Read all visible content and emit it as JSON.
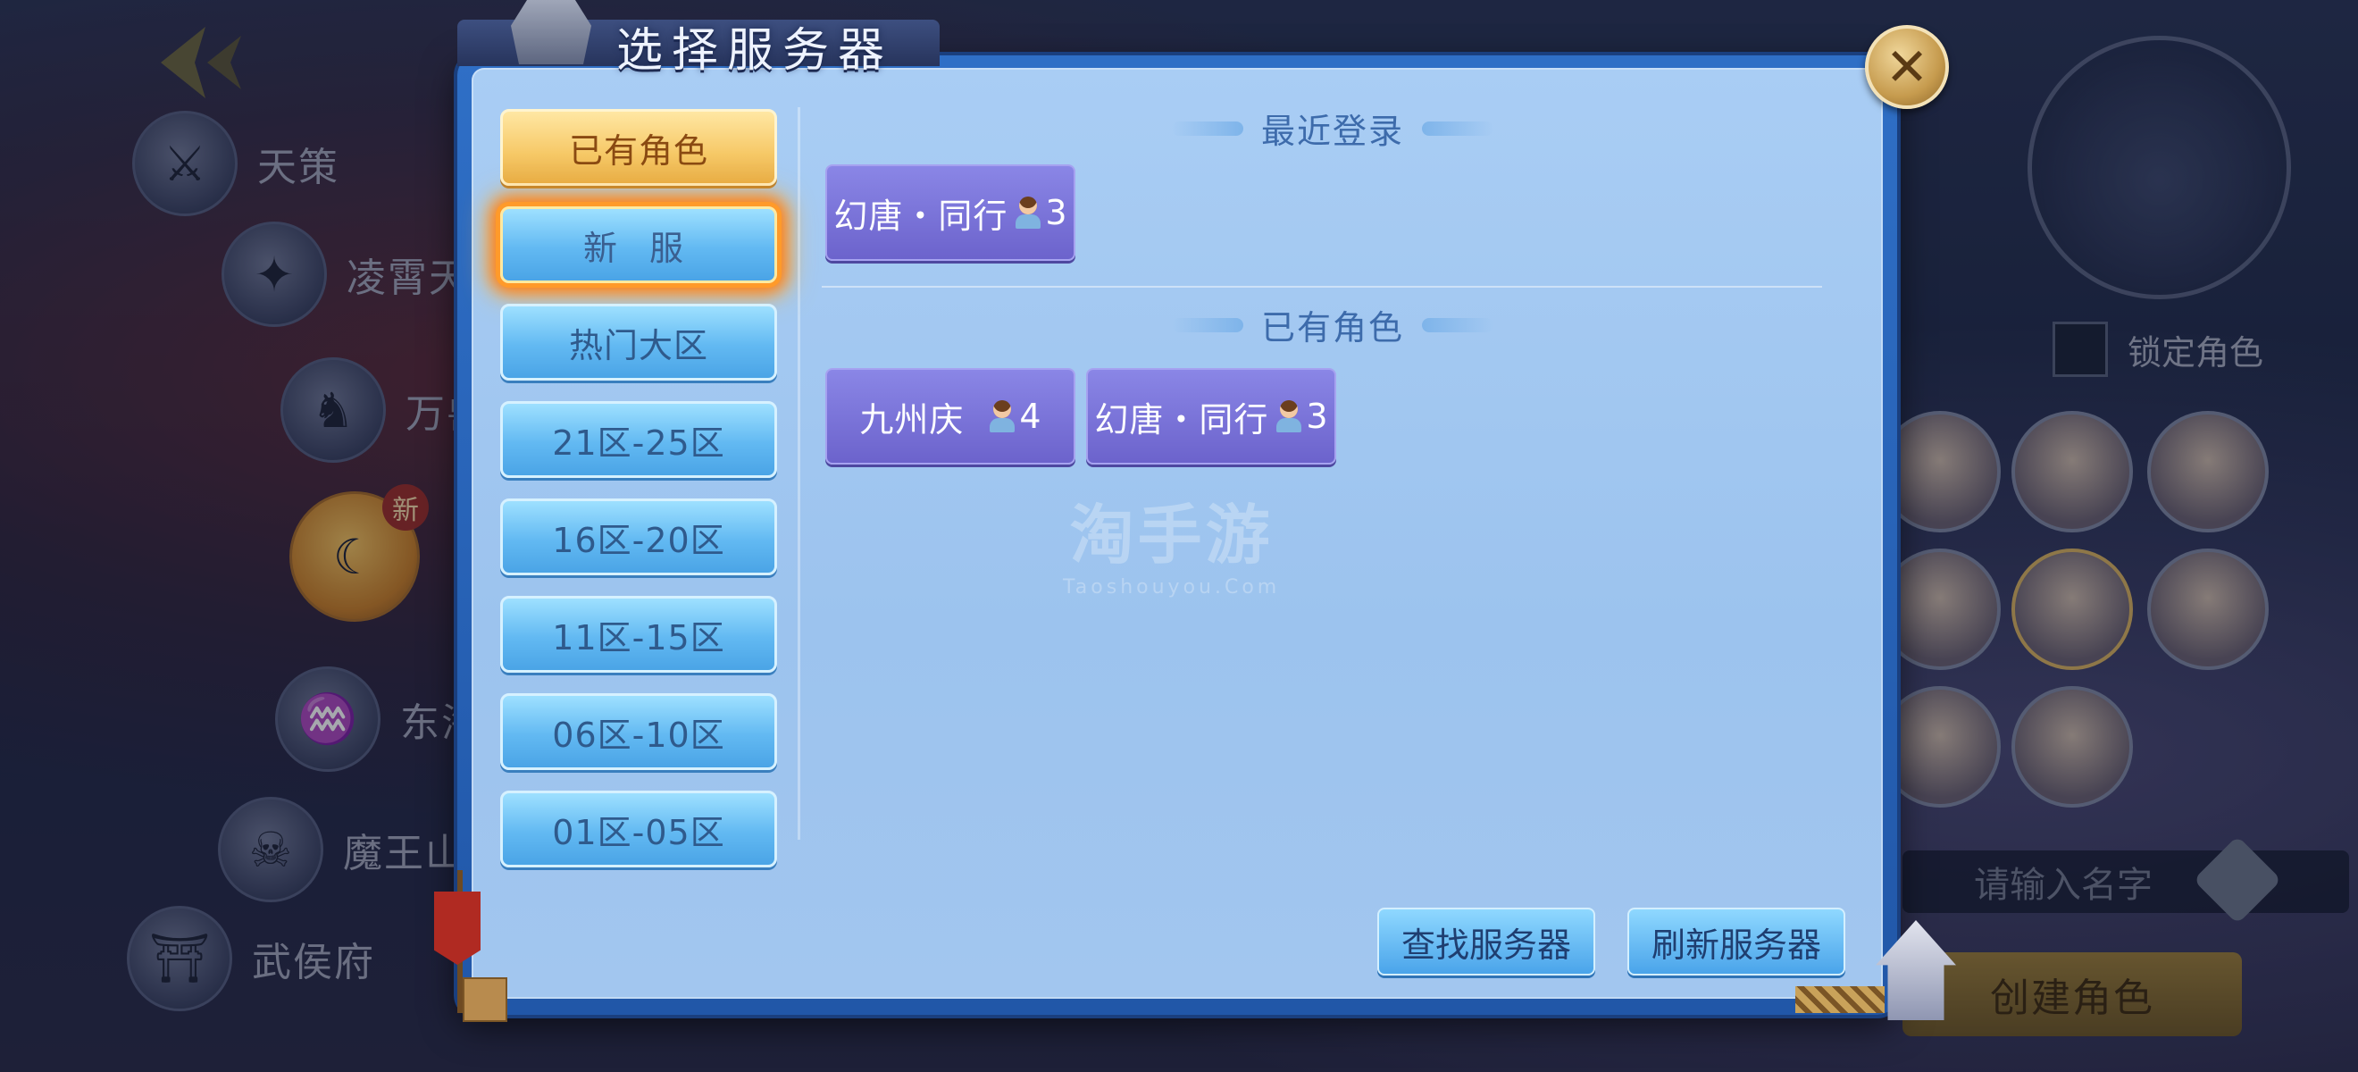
{
  "dialog": {
    "title": "选择服务器",
    "close_symbol": "✕"
  },
  "tabs": [
    {
      "label": "已有角色",
      "state": "selected"
    },
    {
      "label": "新 服",
      "state": "highlight"
    },
    {
      "label": "热门大区",
      "state": "normal"
    },
    {
      "label": "21区-25区",
      "state": "normal"
    },
    {
      "label": "16区-20区",
      "state": "normal"
    },
    {
      "label": "11区-15区",
      "state": "normal"
    },
    {
      "label": "06区-10区",
      "state": "normal"
    },
    {
      "label": "01区-05区",
      "state": "normal"
    }
  ],
  "recent": {
    "title": "最近登录",
    "servers": [
      {
        "name": "幻唐・同行",
        "count": "3"
      }
    ]
  },
  "owned": {
    "title": "已有角色",
    "servers": [
      {
        "name": "九州庆",
        "count": "4"
      },
      {
        "name": "幻唐・同行",
        "count": "3"
      }
    ]
  },
  "watermark": {
    "big": "淘手游",
    "small": "Taoshouyou.Com"
  },
  "actions": {
    "find": "查找服务器",
    "refresh": "刷新服务器"
  },
  "background": {
    "factions": [
      "天策",
      "凌霄天",
      "万兽",
      "",
      "东海",
      "魔王山",
      "武侯府"
    ],
    "new_badge": "新",
    "lock_label": "锁定角色",
    "name_placeholder": "请输入名字",
    "create_button": "创建角色"
  },
  "colors": {
    "dialog_frame": "#2157a8",
    "dialog_body": "#a9cdf4",
    "tab_blue": "#62b9f2",
    "tab_gold": "#f6c866",
    "server_purple": "#6c63cc",
    "new_glow": "#ff7a14"
  }
}
